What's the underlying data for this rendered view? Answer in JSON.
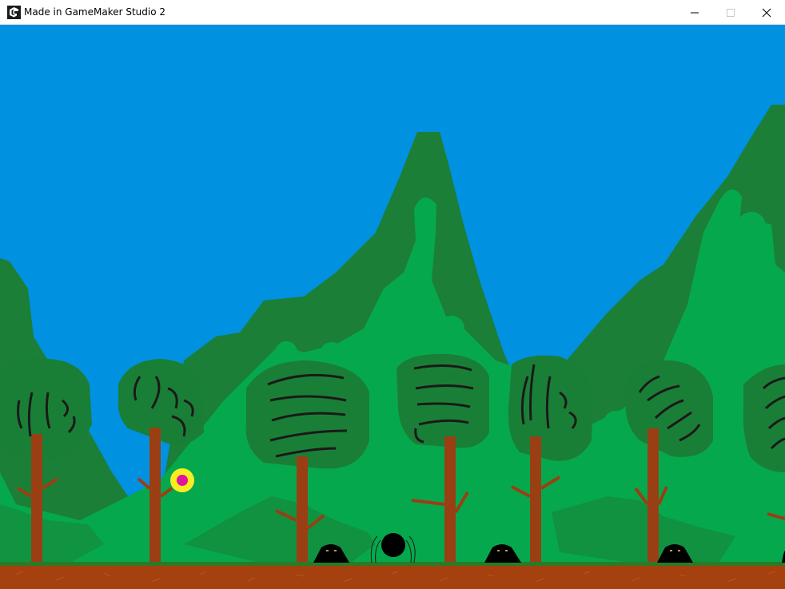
{
  "window": {
    "title": "Made in GameMaker Studio 2",
    "icons": {
      "app": "gamemaker-icon",
      "minimize": "minimize-icon",
      "maximize": "maximize-icon",
      "close": "close-icon"
    }
  },
  "colors": {
    "sky": "#0091e1",
    "mountain_dark": "#1b7f37",
    "mountain_light": "#06a84d",
    "canopy": "#1a7f36",
    "trunk": "#9a3f14",
    "ground": "#a5400f",
    "grass": "#2b7a26",
    "blob": "#000000",
    "coin_outer": "#f7ee21",
    "coin_inner": "#e0159f"
  }
}
